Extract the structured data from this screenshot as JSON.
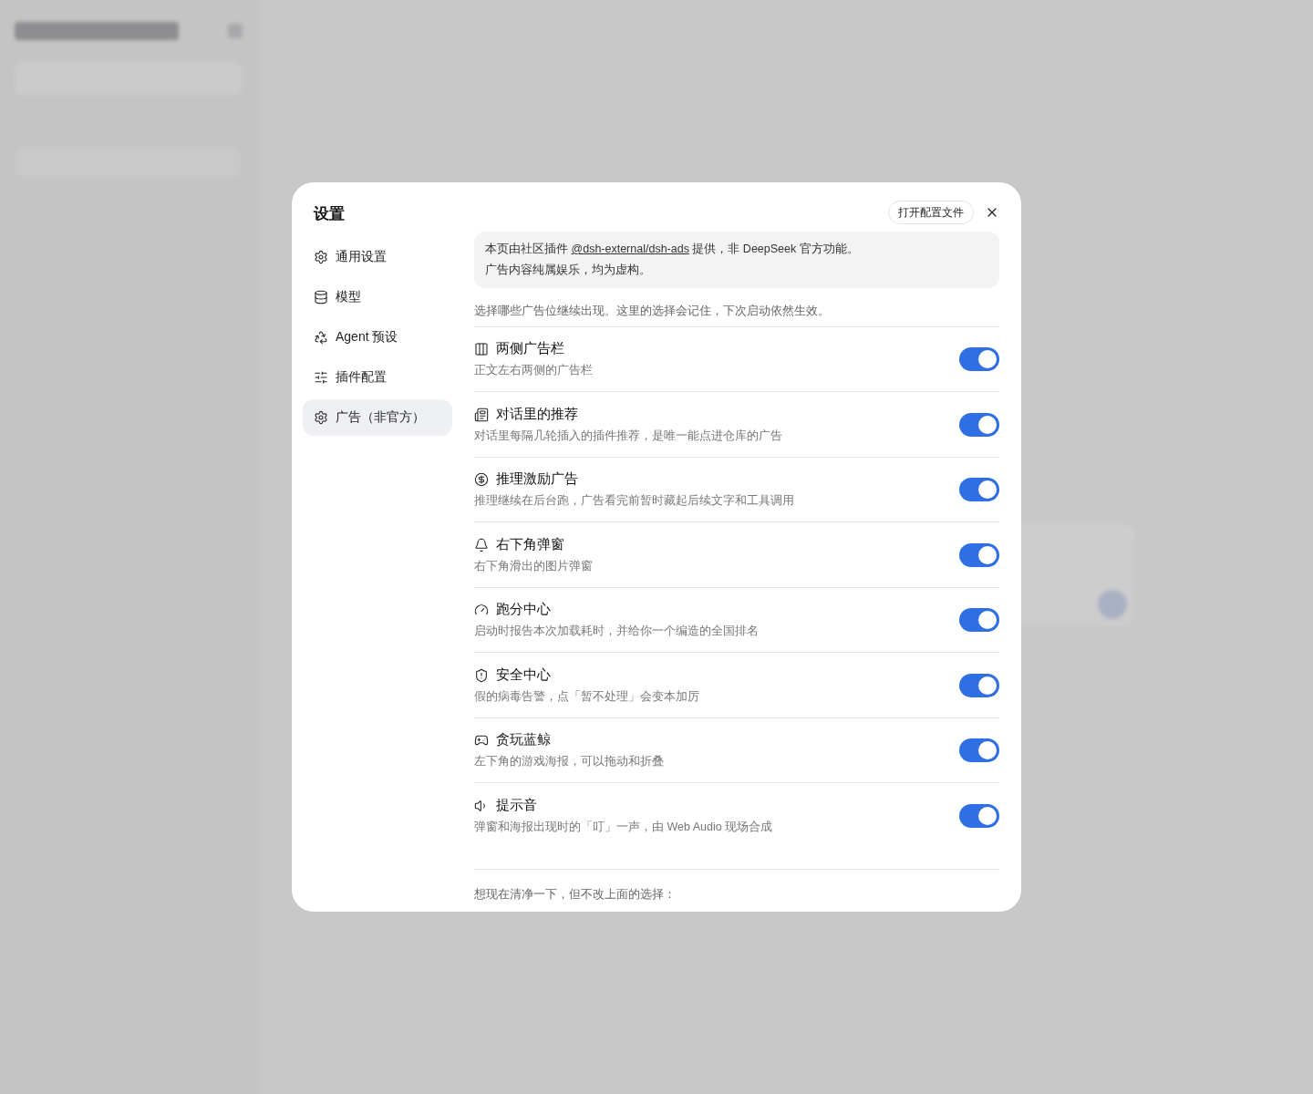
{
  "dialog": {
    "title": "设置",
    "open_config_button": "打开配置文件",
    "nav": [
      {
        "label": "通用设置",
        "selected": false
      },
      {
        "label": "模型",
        "selected": false
      },
      {
        "label": "Agent 预设",
        "selected": false
      },
      {
        "label": "插件配置",
        "selected": false
      },
      {
        "label": "广告（非官方）",
        "selected": true
      }
    ],
    "notice": {
      "before": "本页由社区插件 ",
      "link": "@dsh-external/dsh-ads",
      "after": " 提供，非 DeepSeek 官方功能。",
      "line2": "广告内容纯属娱乐，均为虚构。"
    },
    "intro": "选择哪些广告位继续出现。这里的选择会记住，下次启动依然生效。",
    "settings": [
      {
        "title": "两侧广告栏",
        "description": "正文左右两侧的广告栏",
        "on": true
      },
      {
        "title": "对话里的推荐",
        "description": "对话里每隔几轮插入的插件推荐，是唯一能点进仓库的广告",
        "on": true
      },
      {
        "title": "推理激励广告",
        "description": "推理继续在后台跑，广告看完前暂时藏起后续文字和工具调用",
        "on": true
      },
      {
        "title": "右下角弹窗",
        "description": "右下角滑出的图片弹窗",
        "on": true
      },
      {
        "title": "跑分中心",
        "description": "启动时报告本次加载耗时，并给你一个编造的全国排名",
        "on": true
      },
      {
        "title": "安全中心",
        "description": "假的病毒告警，点「暂不处理」会变本加厉",
        "on": true
      },
      {
        "title": "贪玩蓝鲸",
        "description": "左下角的游戏海报，可以拖动和折叠",
        "on": true
      },
      {
        "title": "提示音",
        "description": "弹窗和海报出现时的「叮」一声，由 Web Audio 现场合成",
        "on": true
      }
    ],
    "footer_note": "想现在清净一下，但不改上面的选择："
  }
}
